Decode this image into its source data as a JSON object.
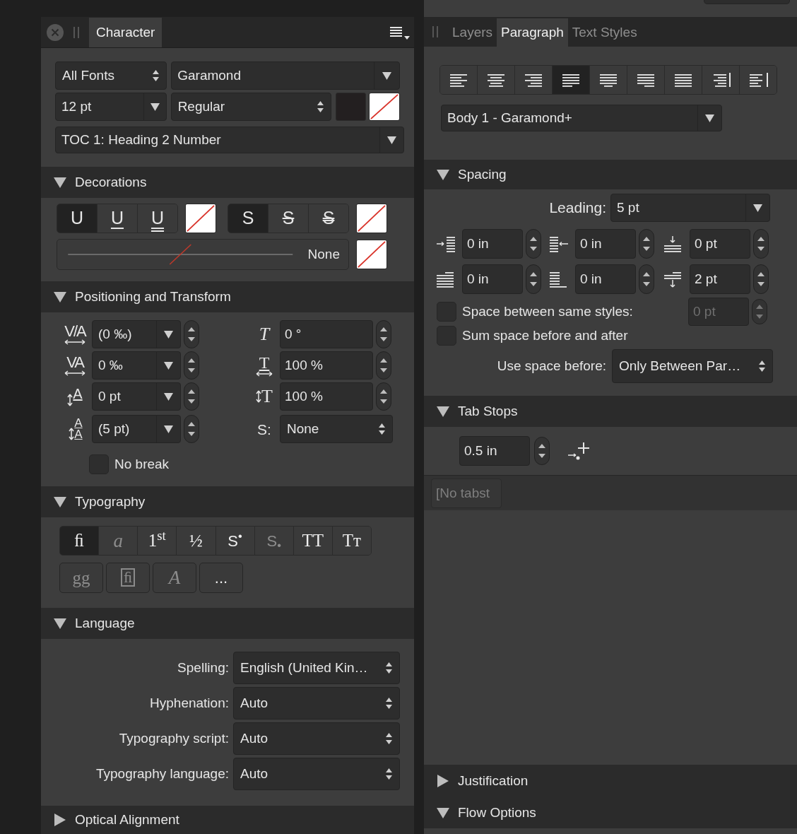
{
  "character_panel": {
    "tabs": [
      {
        "label": "Character",
        "selected": true
      }
    ],
    "font_collection": "All Fonts",
    "font_family": "Garamond",
    "font_size": "12 pt",
    "font_style": "Regular",
    "character_style": "TOC 1: Heading 2 Number",
    "decorations": {
      "title": "Decorations",
      "expanded": true,
      "underline_buttons": [
        {
          "label": "U",
          "kind": "none",
          "selected": true
        },
        {
          "label": "U",
          "kind": "single",
          "selected": false
        },
        {
          "label": "U",
          "kind": "double",
          "selected": false
        }
      ],
      "strike_buttons": [
        {
          "label": "S",
          "kind": "none",
          "selected": true
        },
        {
          "label": "S",
          "kind": "single",
          "selected": false
        },
        {
          "label": "S",
          "kind": "double",
          "selected": false
        }
      ],
      "line_style": "None"
    },
    "positioning": {
      "title": "Positioning and Transform",
      "expanded": true,
      "left_fields": [
        {
          "kind": "tracking",
          "icon": "V/A",
          "value": "(0 ‰)"
        },
        {
          "kind": "kerning",
          "icon": "VA",
          "value": "0 ‰"
        },
        {
          "kind": "baseline",
          "icon": "A",
          "value": "0 pt"
        },
        {
          "kind": "leading",
          "icon": "AA",
          "value": "(5 pt)"
        }
      ],
      "right_fields": [
        {
          "kind": "skew",
          "icon": "T",
          "value": "0 °"
        },
        {
          "kind": "hscale",
          "icon": "T",
          "value": "100 %"
        },
        {
          "kind": "vscale",
          "icon": "T",
          "value": "100 %"
        },
        {
          "kind": "style",
          "icon": "S:",
          "value": "None"
        }
      ],
      "no_break": {
        "label": "No break",
        "checked": false
      }
    },
    "typography": {
      "title": "Typography",
      "expanded": true,
      "row_1": [
        {
          "label": "ﬁ",
          "kind": "plain",
          "selected": true,
          "disabled": false
        },
        {
          "label": "a",
          "kind": "italic",
          "selected": false,
          "disabled": true
        },
        {
          "label": "1$^{st}$",
          "kind": "plain",
          "selected": false,
          "disabled": false
        },
        {
          "label": "½",
          "kind": "plain",
          "selected": false,
          "disabled": false
        },
        {
          "label": "S$^{•}$",
          "kind": "sans",
          "selected": false,
          "disabled": false
        },
        {
          "label": "S$_{•}$",
          "kind": "sans",
          "selected": false,
          "disabled": true
        },
        {
          "label": "TT",
          "kind": "plain",
          "selected": false,
          "disabled": false
        },
        {
          "label": "Tᴛ",
          "kind": "plain",
          "selected": false,
          "disabled": false
        }
      ],
      "row_2": [
        {
          "label": "gg",
          "kind": "plain",
          "disabled": true
        },
        {
          "label": "ﬁ",
          "kind": "boxed",
          "disabled": true
        },
        {
          "label": "A",
          "kind": "italic",
          "disabled": true
        },
        {
          "label": "...",
          "kind": "sans",
          "disabled": false
        }
      ]
    },
    "language": {
      "title": "Language",
      "expanded": true,
      "rows": [
        {
          "label": "Spelling:",
          "value": "English (United Kin…"
        },
        {
          "label": "Hyphenation:",
          "value": "Auto"
        },
        {
          "label": "Typography script:",
          "value": "Auto"
        },
        {
          "label": "Typography language:",
          "value": "Auto"
        }
      ]
    },
    "optical_alignment": {
      "title": "Optical Alignment",
      "expanded": false
    }
  },
  "paragraph_panel": {
    "tabs": [
      {
        "label": "Layers",
        "selected": false
      },
      {
        "label": "Paragraph",
        "selected": true
      },
      {
        "label": "Text Styles",
        "selected": false
      }
    ],
    "alignment": [
      {
        "kind": "left",
        "selected": false
      },
      {
        "kind": "center",
        "selected": false
      },
      {
        "kind": "right",
        "selected": false
      },
      {
        "kind": "justify_left",
        "selected": true
      },
      {
        "kind": "justify_center",
        "selected": false
      },
      {
        "kind": "justify_right",
        "selected": false
      },
      {
        "kind": "justify_all",
        "selected": false
      },
      {
        "kind": "towards_spine",
        "selected": false
      },
      {
        "kind": "away_from_spine",
        "selected": false
      }
    ],
    "paragraph_style": "Body 1 - Garamond+",
    "spacing": {
      "title": "Spacing",
      "expanded": true,
      "leading_label": "Leading:",
      "leading_value": "5 pt",
      "fields": [
        {
          "kind": "left_indent",
          "value": "0 in"
        },
        {
          "kind": "right_indent",
          "value": "0 in"
        },
        {
          "kind": "space_before",
          "value": "0 pt"
        },
        {
          "kind": "first_line_indent",
          "value": "0 in"
        },
        {
          "kind": "last_line_indent",
          "value": "0 in"
        },
        {
          "kind": "space_after",
          "value": "2 pt"
        }
      ],
      "options": [
        {
          "label": "Space between same styles:",
          "checked": false,
          "value": "0 pt",
          "value_disabled": true
        },
        {
          "label": "Sum space before and after",
          "checked": false
        }
      ],
      "use_space_before_label": "Use space before:",
      "use_space_before_value": "Only Between Par…"
    },
    "tab_stops": {
      "title": "Tab Stops",
      "expanded": true,
      "position": "0.5 in",
      "stops": [
        "[No tabst"
      ]
    },
    "justification": {
      "title": "Justification",
      "expanded": false
    },
    "flow_options": {
      "title": "Flow Options",
      "expanded": true
    }
  }
}
